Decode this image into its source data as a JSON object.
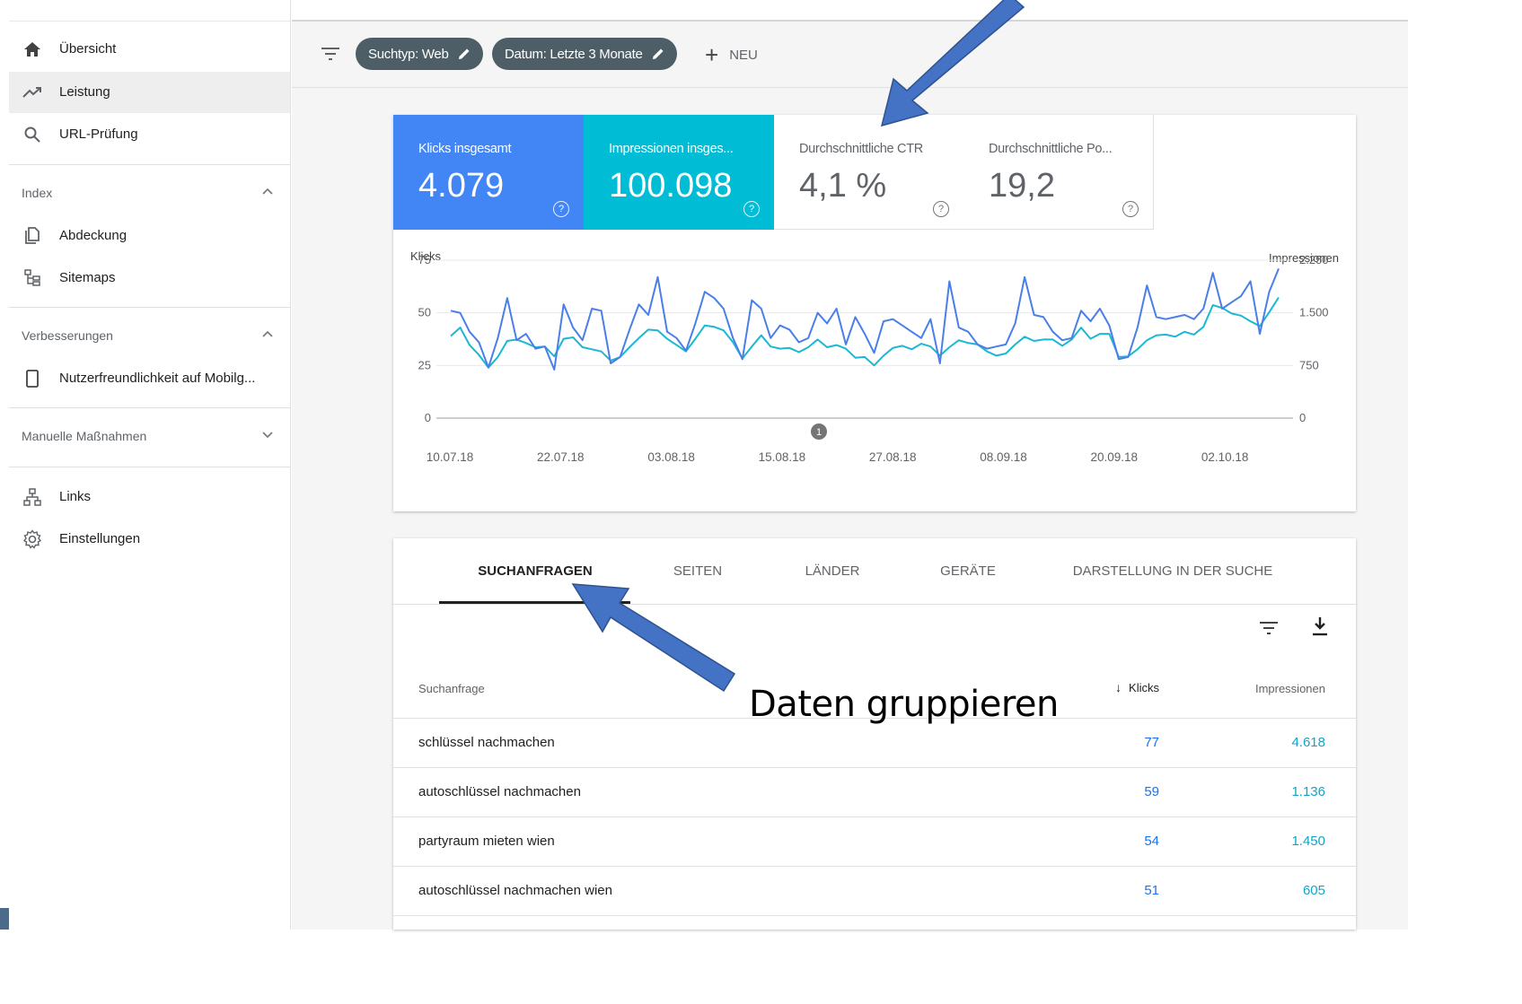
{
  "sidebar": {
    "items": [
      {
        "label": "Übersicht",
        "icon": "home-icon"
      },
      {
        "label": "Leistung",
        "icon": "trending-up-icon",
        "active": true
      },
      {
        "label": "URL-Prüfung",
        "icon": "search-icon"
      }
    ],
    "sections": [
      {
        "label": "Index",
        "expanded": true,
        "items": [
          {
            "label": "Abdeckung",
            "icon": "copy-icon"
          },
          {
            "label": "Sitemaps",
            "icon": "sitemap-icon"
          }
        ]
      },
      {
        "label": "Verbesserungen",
        "expanded": true,
        "items": [
          {
            "label": "Nutzerfreundlichkeit auf Mobilg...",
            "icon": "smartphone-icon"
          }
        ]
      },
      {
        "label": "Manuelle Maßnahmen",
        "expanded": false,
        "items": []
      }
    ],
    "bottom_items": [
      {
        "label": "Links",
        "icon": "links-icon"
      },
      {
        "label": "Einstellungen",
        "icon": "gear-icon"
      }
    ]
  },
  "filters": {
    "chips": [
      "Suchtyp: Web",
      "Datum: Letzte 3 Monate"
    ],
    "new_label": "NEU"
  },
  "metrics": [
    {
      "label": "Klicks insgesamt",
      "value": "4.079",
      "color": "#4285f4",
      "selected": true
    },
    {
      "label": "Impressionen insges...",
      "value": "100.098",
      "color": "#00bcd4",
      "selected": true
    },
    {
      "label": "Durchschnittliche CTR",
      "value": "4,1 %",
      "selected": false
    },
    {
      "label": "Durchschnittliche Po...",
      "value": "19,2",
      "selected": false
    }
  ],
  "chart_data": {
    "type": "line",
    "left_axis_label": "Klicks",
    "right_axis_label": "Impressionen",
    "left_ylim": [
      0,
      75
    ],
    "right_ylim": [
      0,
      2250
    ],
    "left_ticks": [
      "75",
      "50",
      "25",
      "0"
    ],
    "right_ticks": [
      "2.250",
      "1.500",
      "750",
      "0"
    ],
    "x_tick_labels": [
      "10.07.18",
      "22.07.18",
      "03.08.18",
      "15.08.18",
      "27.08.18",
      "08.09.18",
      "20.09.18",
      "02.10.18"
    ],
    "annotation_marker": "1",
    "series": [
      {
        "name": "Klicks",
        "color": "#4a7ee8",
        "values": [
          51,
          50,
          41,
          36,
          24,
          38,
          57,
          37,
          40,
          33,
          34,
          23,
          54,
          43,
          37,
          52,
          51,
          26,
          29,
          42,
          54,
          49,
          67,
          41,
          38,
          32,
          45,
          60,
          57,
          52,
          38,
          28,
          56,
          52,
          38,
          44,
          42,
          36,
          38,
          50,
          45,
          52,
          35,
          48,
          40,
          31,
          46,
          47,
          44,
          41,
          38,
          47,
          26,
          65,
          43,
          41,
          35,
          33,
          34,
          35,
          45,
          67,
          49,
          48,
          41,
          37,
          38,
          51,
          46,
          52,
          44,
          28,
          29,
          43,
          63,
          48,
          47,
          48,
          49,
          47,
          52,
          69,
          52,
          55,
          58,
          65,
          40,
          60,
          71
        ]
      },
      {
        "name": "Impressionen",
        "color": "#1bb8d4",
        "values": [
          1170,
          1290,
          1040,
          900,
          720,
          870,
          1100,
          1120,
          1070,
          1010,
          1020,
          880,
          1130,
          1150,
          1010,
          980,
          950,
          820,
          870,
          1010,
          1140,
          1260,
          1250,
          1130,
          1040,
          950,
          1130,
          1320,
          1300,
          1250,
          1080,
          850,
          1020,
          1180,
          1020,
          990,
          1000,
          940,
          1010,
          1120,
          1010,
          1040,
          990,
          860,
          870,
          750,
          890,
          1000,
          1030,
          980,
          1060,
          1020,
          890,
          1010,
          1110,
          1070,
          1050,
          950,
          890,
          920,
          1050,
          1160,
          1100,
          1120,
          1120,
          1030,
          1120,
          1290,
          1130,
          1200,
          1200,
          870,
          880,
          980,
          1110,
          1180,
          1190,
          1160,
          1230,
          1190,
          1300,
          1610,
          1570,
          1490,
          1460,
          1380,
          1310,
          1510,
          1720
        ]
      }
    ]
  },
  "table": {
    "tabs": [
      "SUCHANFRAGEN",
      "SEITEN",
      "LÄNDER",
      "GERÄTE",
      "DARSTELLUNG IN DER SUCHE"
    ],
    "active_tab": 0,
    "columns": {
      "query": "Suchanfrage",
      "clicks": "Klicks",
      "impressions": "Impressionen"
    },
    "rows": [
      {
        "query": "schlüssel nachmachen",
        "clicks": "77",
        "impressions": "4.618"
      },
      {
        "query": "autoschlüssel nachmachen",
        "clicks": "59",
        "impressions": "1.136"
      },
      {
        "query": "partyraum mieten wien",
        "clicks": "54",
        "impressions": "1.450"
      },
      {
        "query": "autoschlüssel nachmachen wien",
        "clicks": "51",
        "impressions": "605"
      }
    ]
  },
  "annotation": {
    "text": "Daten gruppieren",
    "arrow_color": "#4472c4"
  }
}
